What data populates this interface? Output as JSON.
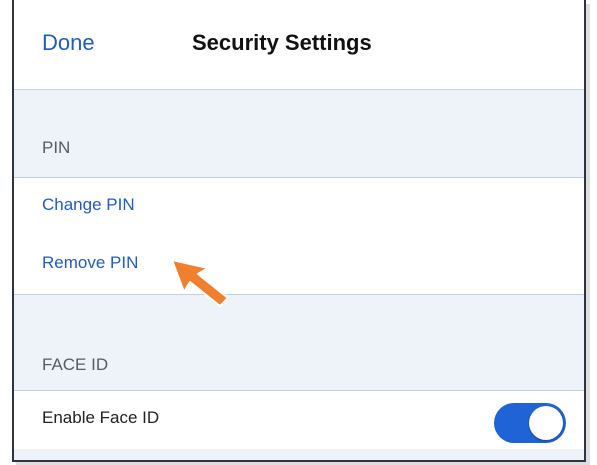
{
  "nav": {
    "done_label": "Done",
    "title": "Security Settings"
  },
  "sections": {
    "pin": {
      "header": "PIN",
      "items": [
        {
          "label": "Change PIN"
        },
        {
          "label": "Remove PIN"
        }
      ]
    },
    "face_id": {
      "header": "FACE ID",
      "items": [
        {
          "label": "Enable Face ID",
          "toggle_on": true
        }
      ]
    }
  },
  "colors": {
    "accent": "#1f5cc4",
    "toggle_on": "#1f63d6",
    "group_background": "#eef3fa",
    "pointer_arrow": "#f07f2e"
  },
  "annotation": {
    "icon": "pointer-arrow-icon"
  }
}
